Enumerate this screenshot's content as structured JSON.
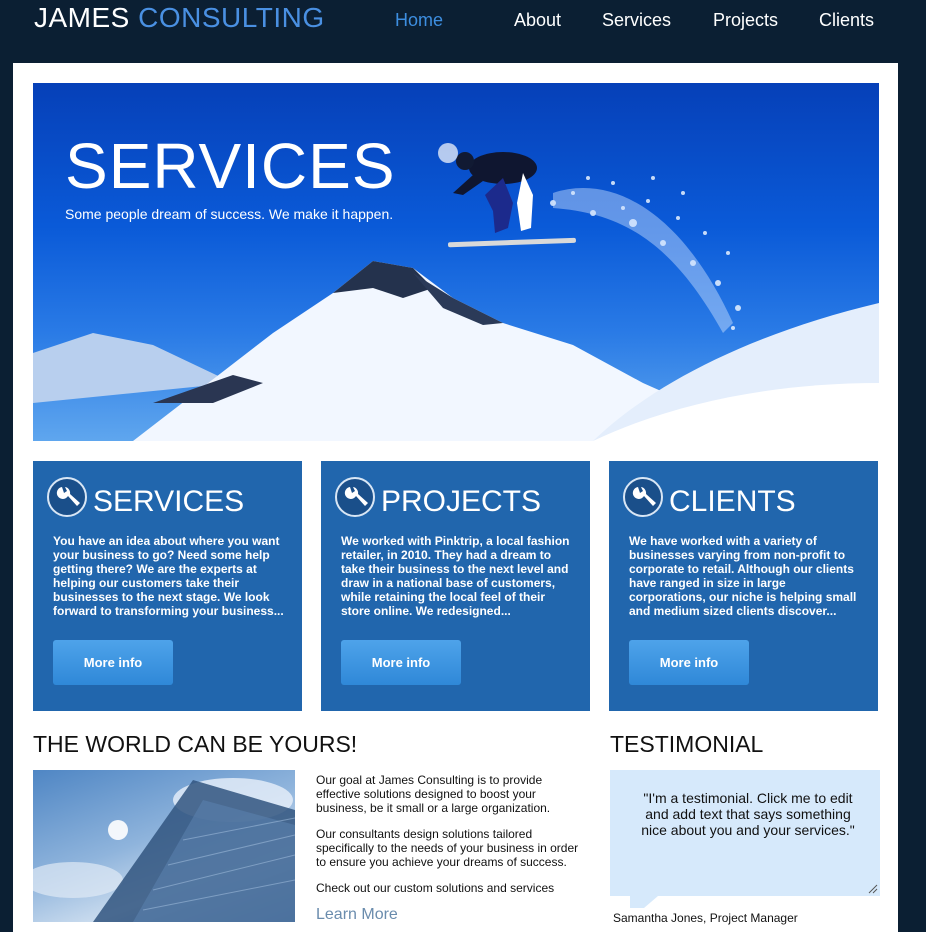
{
  "brand": {
    "name_primary": "JAMES",
    "name_accent": "CONSULTING"
  },
  "nav": [
    {
      "label": "Home",
      "active": true
    },
    {
      "label": "About",
      "active": false
    },
    {
      "label": "Services",
      "active": false
    },
    {
      "label": "Projects",
      "active": false
    },
    {
      "label": "Clients",
      "active": false
    }
  ],
  "hero": {
    "title": "SERVICES",
    "subtitle": "Some people dream of success. We make it happen."
  },
  "cards": [
    {
      "title": "SERVICES",
      "text": "You have an idea about where you want your business to go? Need some help getting there? We are the experts at helping our customers take their businesses to the next stage. We look forward to transforming your business...",
      "button": "More info",
      "icon": "wrench-icon"
    },
    {
      "title": "PROJECTS",
      "text": "We worked with Pinktrip, a local fashion retailer, in 2010. They had a dream to take their business to the next level and draw in a national base of customers, while retaining the local feel of their store online. We redesigned...",
      "button": "More info",
      "icon": "wrench-icon"
    },
    {
      "title": "CLIENTS",
      "text": "We have worked with a variety of businesses varying from non-profit to corporate to retail. Although our clients have ranged in size in large corporations, our niche is helping small and medium sized clients discover...",
      "button": "More info",
      "icon": "wrench-icon"
    }
  ],
  "world": {
    "title": "THE WORLD CAN BE YOURS!",
    "paragraphs": [
      "Our goal at James Consulting is to provide effective solutions designed to boost your business, be it small or a large organization.",
      "Our consultants design solutions tailored specifically to the needs of your business in order to ensure you achieve your dreams of success.",
      "Check out our custom solutions and services"
    ],
    "link": "Learn More"
  },
  "testimonial": {
    "title": "TESTIMONIAL",
    "quote": "\"I'm a testimonial. Click me to edit and add text that says something nice about you and your services.\"",
    "author": "Samantha Jones, Project Manager"
  },
  "colors": {
    "background": "#0b1f33",
    "accent": "#4a90e2",
    "card": "#2166ad",
    "testimonial_bg": "#d6e9fb"
  }
}
